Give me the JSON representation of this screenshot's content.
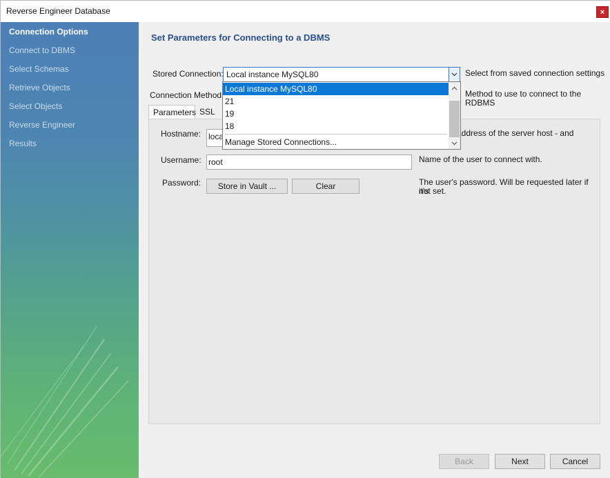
{
  "window": {
    "title": "Reverse Engineer Database",
    "close_icon": "×"
  },
  "sidebar": {
    "items": [
      {
        "label": "Connection Options",
        "active": true
      },
      {
        "label": "Connect to DBMS",
        "active": false
      },
      {
        "label": "Select Schemas",
        "active": false
      },
      {
        "label": "Retrieve Objects",
        "active": false
      },
      {
        "label": "Select Objects",
        "active": false
      },
      {
        "label": "Reverse Engineer",
        "active": false
      },
      {
        "label": "Results",
        "active": false
      }
    ]
  },
  "main": {
    "heading": "Set Parameters for Connecting to a DBMS",
    "stored_connection": {
      "label": "Stored Connection:",
      "value": "Local instance MySQL80",
      "hint": "Select from saved connection settings",
      "options": [
        "Local instance MySQL80",
        "21",
        "19",
        "18"
      ],
      "manage_label": "Manage Stored Connections..."
    },
    "connection_method": {
      "label": "Connection Method:",
      "hint": "Method to use to connect to the RDBMS"
    },
    "tabs": [
      "Parameters",
      "SSL"
    ],
    "hostname": {
      "label": "Hostname:",
      "value": "locall",
      "hint": "address of the server host - and"
    },
    "username": {
      "label": "Username:",
      "value": "root",
      "hint": "Name of the user to connect with."
    },
    "password": {
      "label": "Password:",
      "store_label": "Store in Vault ...",
      "clear_label": "Clear",
      "hint_line1": "The user's password. Will be requested later if it's",
      "hint_line2": "not set."
    }
  },
  "footer": {
    "back_label": "Back",
    "next_label": "Next",
    "cancel_label": "Cancel"
  },
  "icons": {
    "dropdown_arrow": "chevron-down-icon",
    "scroll_up": "chevron-up-icon",
    "scroll_down": "chevron-down-icon"
  },
  "colors": {
    "heading": "#2a4f8c",
    "selection": "#0a78d7",
    "close": "#c5262a"
  }
}
